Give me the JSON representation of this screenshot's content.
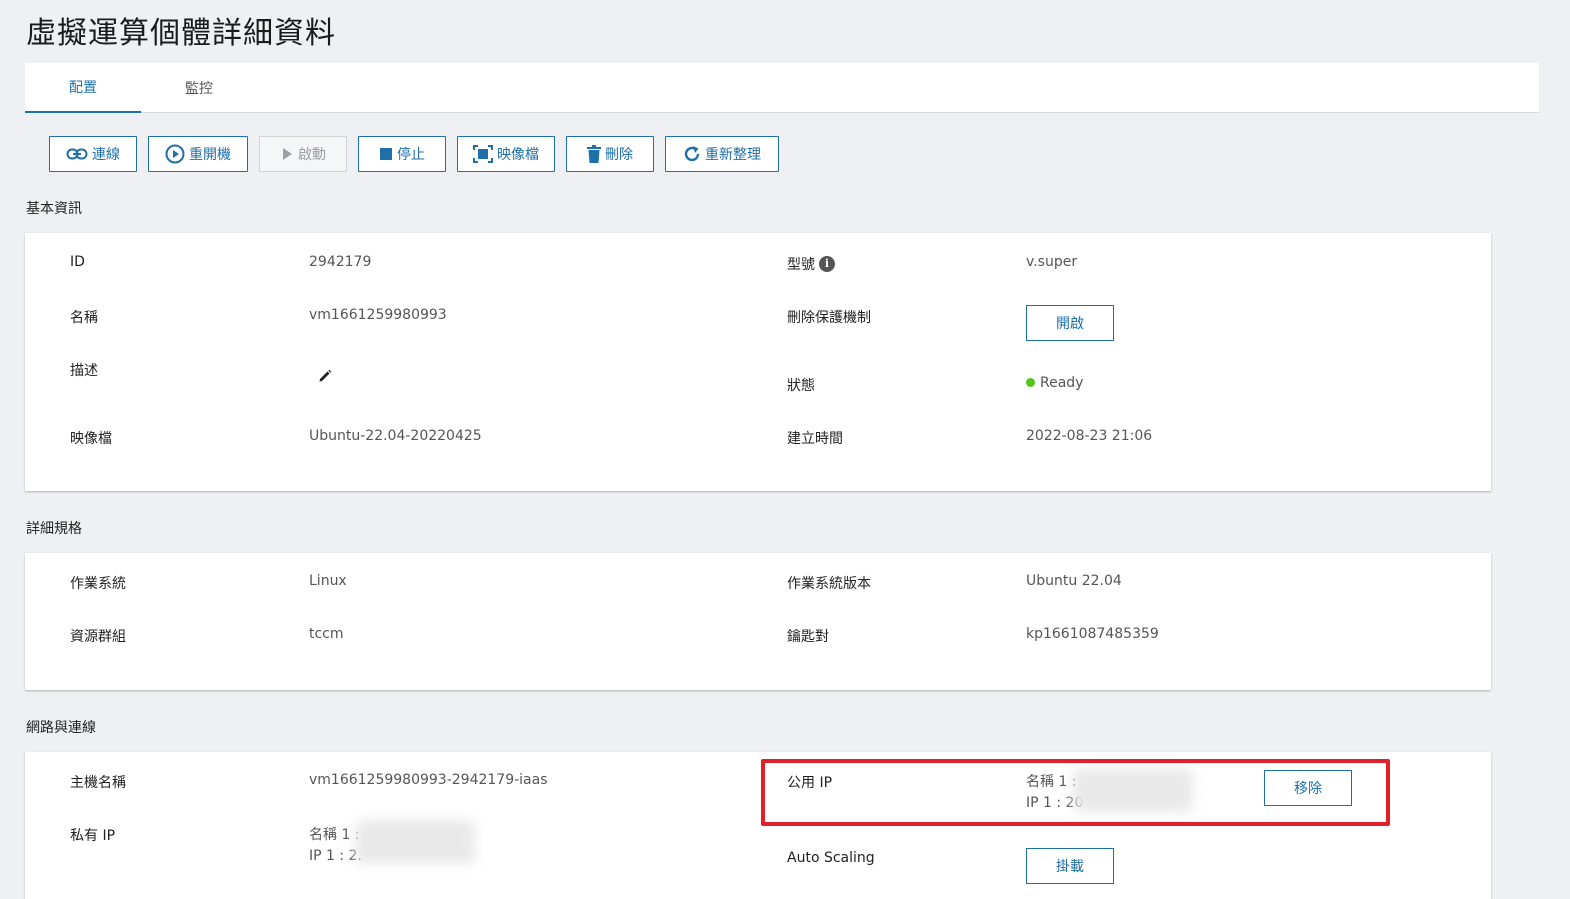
{
  "page_title": "虛擬運算個體詳細資料",
  "tabs": [
    {
      "label": "配置",
      "active": true
    },
    {
      "label": "監控",
      "active": false
    }
  ],
  "toolbar": {
    "connect": "連線",
    "reboot": "重開機",
    "start": "啟動",
    "stop": "停止",
    "image": "映像檔",
    "delete": "刪除",
    "refresh": "重新整理"
  },
  "sections": {
    "basic": "基本資訊",
    "spec": "詳細規格",
    "network": "網路與連線"
  },
  "basic": {
    "id_label": "ID",
    "id_value": "2942179",
    "name_label": "名稱",
    "name_value": "vm1661259980993",
    "desc_label": "描述",
    "image_label": "映像檔",
    "image_value": "Ubuntu-22.04-20220425",
    "type_label": "型號",
    "type_value": "v.super",
    "delete_protect_label": "刪除保護機制",
    "delete_protect_button": "開啟",
    "status_label": "狀態",
    "status_value": "Ready",
    "created_label": "建立時間",
    "created_value": "2022-08-23 21:06"
  },
  "spec": {
    "os_label": "作業系統",
    "os_value": "Linux",
    "rg_label": "資源群組",
    "rg_value": "tccm",
    "os_version_label": "作業系統版本",
    "os_version_value": "Ubuntu 22.04",
    "keypair_label": "鑰匙對",
    "keypair_value": "kp1661087485359"
  },
  "network": {
    "hostname_label": "主機名稱",
    "hostname_value": "vm1661259980993-2942179-iaas",
    "private_ip_label": "私有 IP",
    "private_ip_name": "名稱 1 :",
    "private_ip_ip": "IP 1 : 2.",
    "public_ip_label": "公用 IP",
    "public_ip_name": "名稱 1 :",
    "public_ip_ip": "IP 1 : 20",
    "remove_button": "移除",
    "autoscaling_label": "Auto Scaling",
    "attach_button": "掛載"
  },
  "colors": {
    "accent": "#1f6fa8",
    "status_ok": "#52c41a",
    "highlight": "#e0202a"
  }
}
